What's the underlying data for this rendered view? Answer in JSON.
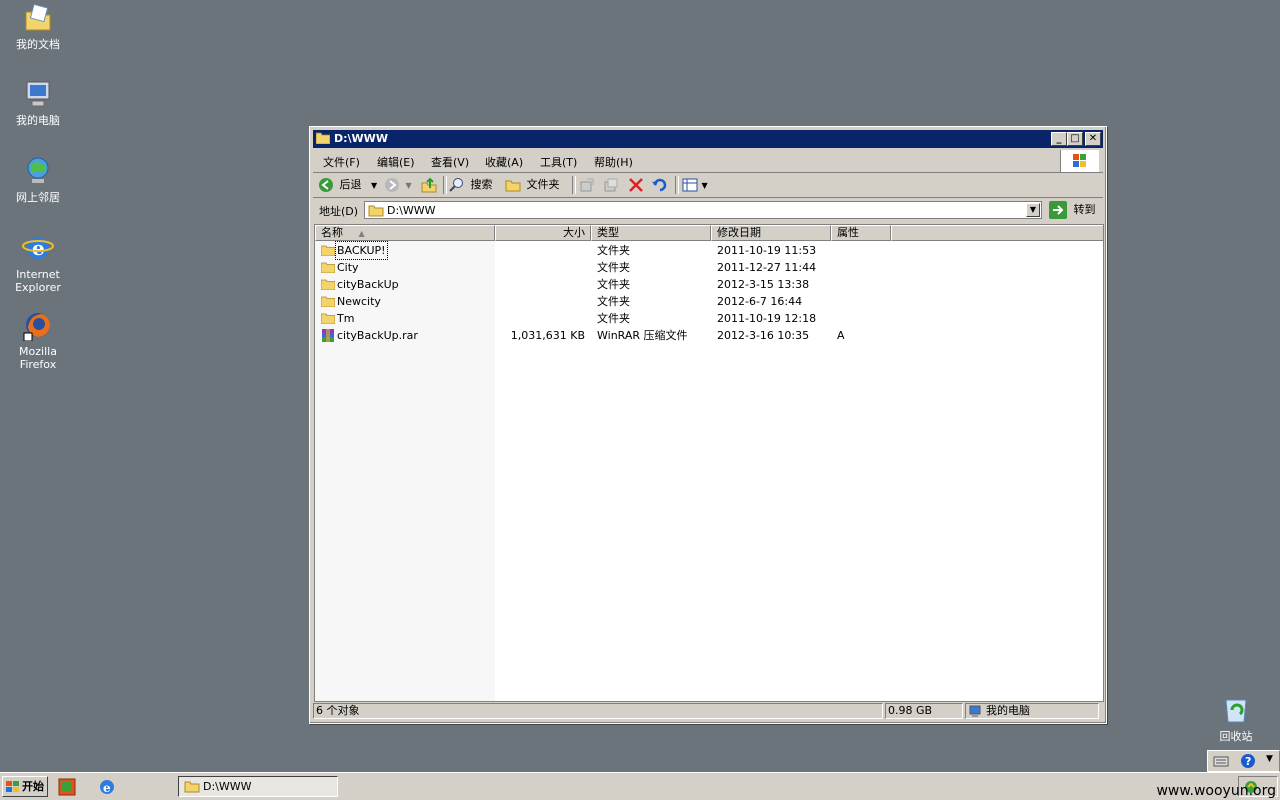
{
  "desktop": {
    "icons": [
      {
        "label": "我的文档"
      },
      {
        "label": "我的电脑"
      },
      {
        "label": "网上邻居"
      },
      {
        "label": "Internet Explorer"
      },
      {
        "label": "Mozilla Firefox"
      },
      {
        "label": "回收站"
      }
    ]
  },
  "window": {
    "title": "D:\\WWW",
    "menu": [
      "文件(F)",
      "编辑(E)",
      "查看(V)",
      "收藏(A)",
      "工具(T)",
      "帮助(H)"
    ],
    "toolbar": {
      "back": "后退",
      "search": "搜索",
      "folders": "文件夹"
    },
    "address": {
      "label": "地址(D)",
      "value": "D:\\WWW",
      "go": "转到"
    },
    "columns": [
      "名称",
      "大小",
      "类型",
      "修改日期",
      "属性"
    ],
    "files": [
      {
        "name": "BACKUP!",
        "size": "",
        "type": "文件夹",
        "date": "2011-10-19 11:53",
        "attr": ""
      },
      {
        "name": "City",
        "size": "",
        "type": "文件夹",
        "date": "2011-12-27 11:44",
        "attr": ""
      },
      {
        "name": "cityBackUp",
        "size": "",
        "type": "文件夹",
        "date": "2012-3-15 13:38",
        "attr": ""
      },
      {
        "name": "Newcity",
        "size": "",
        "type": "文件夹",
        "date": "2012-6-7 16:44",
        "attr": ""
      },
      {
        "name": "Tm",
        "size": "",
        "type": "文件夹",
        "date": "2011-10-19 12:18",
        "attr": ""
      },
      {
        "name": "cityBackUp.rar",
        "size": "1,031,631 KB",
        "type": "WinRAR 压缩文件",
        "date": "2012-3-16 10:35",
        "attr": "A"
      }
    ],
    "status": {
      "count": "6 个对象",
      "size": "0.98 GB",
      "location": "我的电脑"
    }
  },
  "taskbar": {
    "start": "开始",
    "task": "D:\\WWW"
  },
  "watermark": "www.wooyun.org",
  "colors": {
    "desktop": "#6b737b",
    "titlebar": "#0a246a",
    "chrome": "#d4d0c8"
  }
}
